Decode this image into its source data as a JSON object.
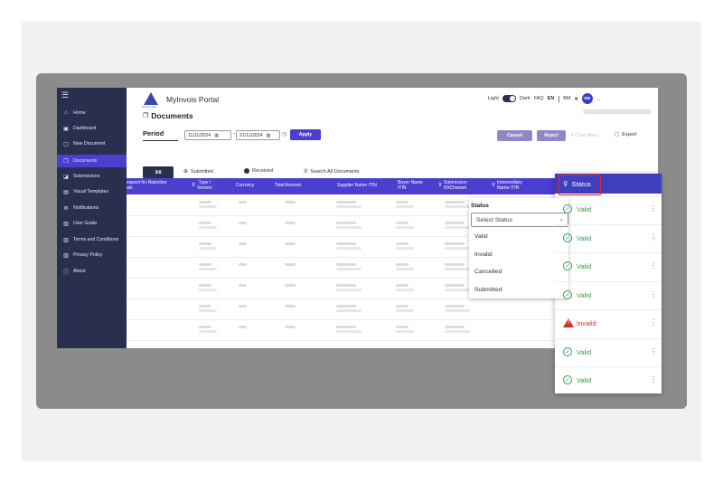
{
  "sidebar": {
    "menu_icon": "hamburger-icon",
    "items": [
      {
        "label": "Home",
        "icon": "home-icon",
        "glyph": "⌂",
        "active": false
      },
      {
        "label": "Dashboard",
        "icon": "dashboard-icon",
        "glyph": "▣",
        "active": false
      },
      {
        "label": "New Document",
        "icon": "new-document-icon",
        "glyph": "▢",
        "active": false
      },
      {
        "label": "Documents",
        "icon": "documents-icon",
        "glyph": "❐",
        "active": true
      },
      {
        "label": "Submissions",
        "icon": "submissions-icon",
        "glyph": "◪",
        "active": false
      },
      {
        "label": "Visual Templates",
        "icon": "templates-icon",
        "glyph": "▤",
        "active": false
      },
      {
        "label": "Notifications",
        "icon": "notifications-icon",
        "glyph": "✉",
        "active": false
      },
      {
        "label": "User Guide",
        "icon": "user-guide-icon",
        "glyph": "▥",
        "active": false
      },
      {
        "label": "Terms and Conditions",
        "icon": "terms-icon",
        "glyph": "▥",
        "active": false
      },
      {
        "label": "Privacy Policy",
        "icon": "privacy-icon",
        "glyph": "▥",
        "active": false
      },
      {
        "label": "About",
        "icon": "about-icon",
        "glyph": "ⓘ",
        "active": false
      }
    ]
  },
  "header": {
    "logo_text": "MALAYSIA",
    "title": "MyInvois Portal",
    "theme_light": "Light",
    "theme_dark": "Dark",
    "faq": "FAQ",
    "lang_en": "EN",
    "separator": "|",
    "lang_bm": "BM",
    "avatar_initials": "EB"
  },
  "page": {
    "title": "Documents",
    "period_label": "Period",
    "date_from": "11/11/2024",
    "date_to": "21/11/2024",
    "date_separator": "-",
    "apply_label": "Apply",
    "cancel_label": "Cancel",
    "reject_label": "Reject",
    "clear_filters_label": "Clear filters",
    "export_label": "Export"
  },
  "tabs": [
    {
      "label": "All",
      "active": true
    },
    {
      "label": "Submitted",
      "active": false
    },
    {
      "label": "Received",
      "active": false
    },
    {
      "label": "Search All Documents",
      "active": false
    }
  ],
  "columns": {
    "rejection": "equest for Rejection\nate",
    "type_version": "Type /\nVersion",
    "currency": "Currency",
    "total_amount": "Total Amount",
    "supplier": "Supplier Name /TIN",
    "buyer": "Buyer Name\n/TIN",
    "submission": "Submission\nID/Channel",
    "intermediary": "Intermediary\nName /TIN",
    "status": "Status"
  },
  "status_filter": {
    "title": "Status",
    "placeholder": "Select Status",
    "options": [
      "Valid",
      "Invalid",
      "Cancelled",
      "Submitted"
    ]
  },
  "rows": [
    {
      "status": "Valid"
    },
    {
      "status": "Valid"
    },
    {
      "status": "Valid"
    },
    {
      "status": "Valid"
    },
    {
      "status": "Invalid"
    },
    {
      "status": "Valid"
    },
    {
      "status": "Valid"
    }
  ],
  "colors": {
    "sidebar": "#2b2f4f",
    "accent": "#4a3fcf",
    "status_header": "#3d3fbf",
    "valid": "#2e9e4a",
    "invalid": "#d12e24",
    "highlight_box": "#e0272e"
  }
}
